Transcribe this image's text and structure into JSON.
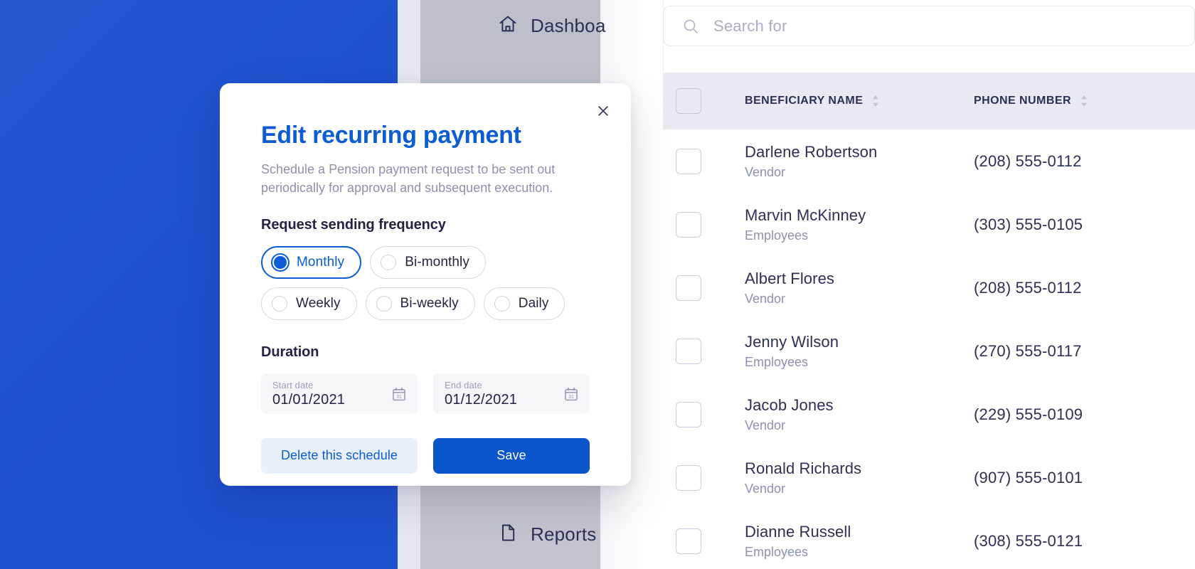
{
  "theme": {
    "brand_blue": "#0b5cd5",
    "panel_blue": "#1f50cf",
    "save_blue": "#0b55cc",
    "delete_bg": "#e8f0fd",
    "nav_grey": "#bcc0ca",
    "table_header_bg": "#e7eaf2",
    "text_dark": "#2b3154",
    "text_muted": "#8a92b2"
  },
  "nav": {
    "items": [
      {
        "label": "Dashboa",
        "icon": "home-icon"
      },
      {
        "label": "Reports",
        "icon": "document-icon"
      }
    ]
  },
  "search": {
    "placeholder": "Search for",
    "value": "",
    "icon": "search-icon"
  },
  "table": {
    "columns": [
      {
        "key": "select",
        "label": "",
        "sortable": false
      },
      {
        "key": "name",
        "label": "BENEFICIARY NAME",
        "sortable": true
      },
      {
        "key": "phone",
        "label": "PHONE NUMBER",
        "sortable": true
      }
    ],
    "rows": [
      {
        "name": "Darlene Robertson",
        "role": "Vendor",
        "phone": "(208) 555-0112",
        "checked": false
      },
      {
        "name": "Marvin McKinney",
        "role": "Employees",
        "phone": "(303) 555-0105",
        "checked": false
      },
      {
        "name": "Albert Flores",
        "role": "Vendor",
        "phone": "(208) 555-0112",
        "checked": false
      },
      {
        "name": "Jenny Wilson",
        "role": "Employees",
        "phone": "(270) 555-0117",
        "checked": false
      },
      {
        "name": "Jacob Jones",
        "role": "Vendor",
        "phone": "(229) 555-0109",
        "checked": false
      },
      {
        "name": "Ronald Richards",
        "role": "Vendor",
        "phone": "(907) 555-0101",
        "checked": false
      },
      {
        "name": "Dianne Russell",
        "role": "Employees",
        "phone": "(308) 555-0121",
        "checked": false
      }
    ]
  },
  "modal": {
    "title": "Edit recurring payment",
    "subtitle": "Schedule a Pension payment request to be sent out periodically for approval and subsequent execution.",
    "close_icon": "close-icon",
    "frequency": {
      "heading": "Request sending frequency",
      "selected": "Monthly",
      "options": [
        {
          "label": "Monthly",
          "selected": true
        },
        {
          "label": "Bi-monthly",
          "selected": false
        },
        {
          "label": "Weekly",
          "selected": false
        },
        {
          "label": "Bi-weekly",
          "selected": false
        },
        {
          "label": "Daily",
          "selected": false
        }
      ]
    },
    "duration": {
      "heading": "Duration",
      "start": {
        "caption": "Start date",
        "value": "01/01/2021",
        "icon": "calendar-icon"
      },
      "end": {
        "caption": "End date",
        "value": "01/12/2021",
        "icon": "calendar-icon"
      }
    },
    "actions": {
      "delete_label": "Delete this schedule",
      "save_label": "Save"
    }
  }
}
